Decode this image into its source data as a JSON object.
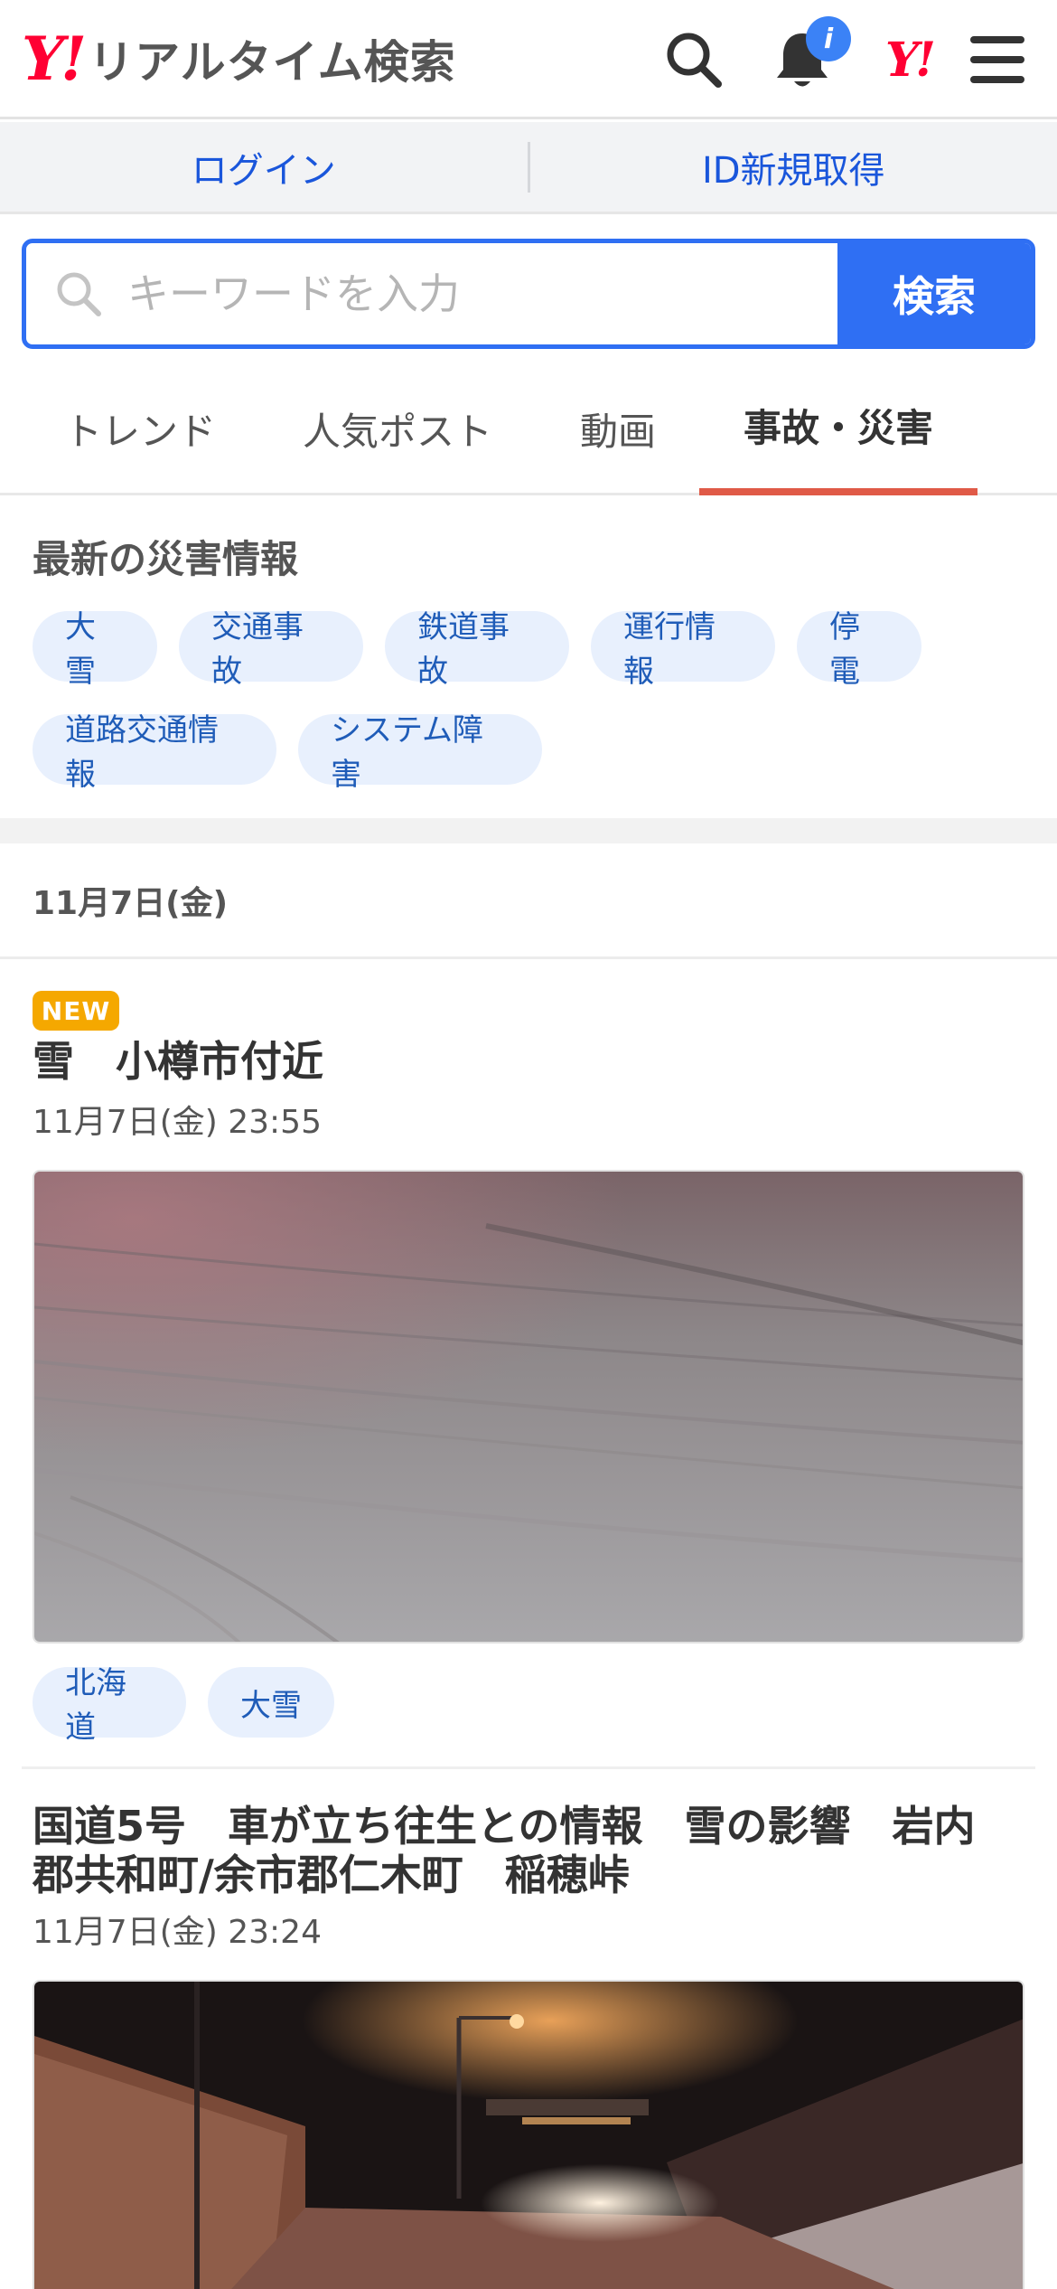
{
  "header": {
    "logo_mark": "Y!",
    "logo_text": "リアルタイム検索",
    "notification_badge": "i",
    "yahoo_mark": "Y!"
  },
  "loginbar": {
    "login": "ログイン",
    "signup": "ID新規取得"
  },
  "search": {
    "placeholder": "キーワードを入力",
    "button": "検索"
  },
  "tabs": [
    {
      "label": "トレンド"
    },
    {
      "label": "人気ポスト"
    },
    {
      "label": "動画"
    },
    {
      "label": "事故・災害",
      "active": true
    }
  ],
  "disaster": {
    "title": "最新の災害情報",
    "chips": [
      "大雪",
      "交通事故",
      "鉄道事故",
      "運行情報",
      "停電",
      "道路交通情報",
      "システム障害"
    ]
  },
  "date_heading": "11月7日(金)",
  "posts": [
    {
      "badge": "NEW",
      "title": "雪　小樽市付近",
      "time": "11月7日(金) 23:55",
      "tags": [
        "北海道",
        "大雪"
      ]
    },
    {
      "title_line1": "国道5号　車が立ち往生との情報　雪の影響　岩内",
      "title_line2": "郡共和町/余市郡仁木町　稲穂峠",
      "time": "11月7日(金) 23:24"
    }
  ],
  "colors": {
    "brand_red": "#ff0033",
    "accent_blue": "#2f6ff3",
    "link_blue": "#1a56db",
    "tab_underline": "#e05a47",
    "chip_bg": "#e8f0fd",
    "new_badge": "#f5a800"
  },
  "icons": [
    "search-icon",
    "bell-icon",
    "menu-icon",
    "magnifier-icon"
  ]
}
